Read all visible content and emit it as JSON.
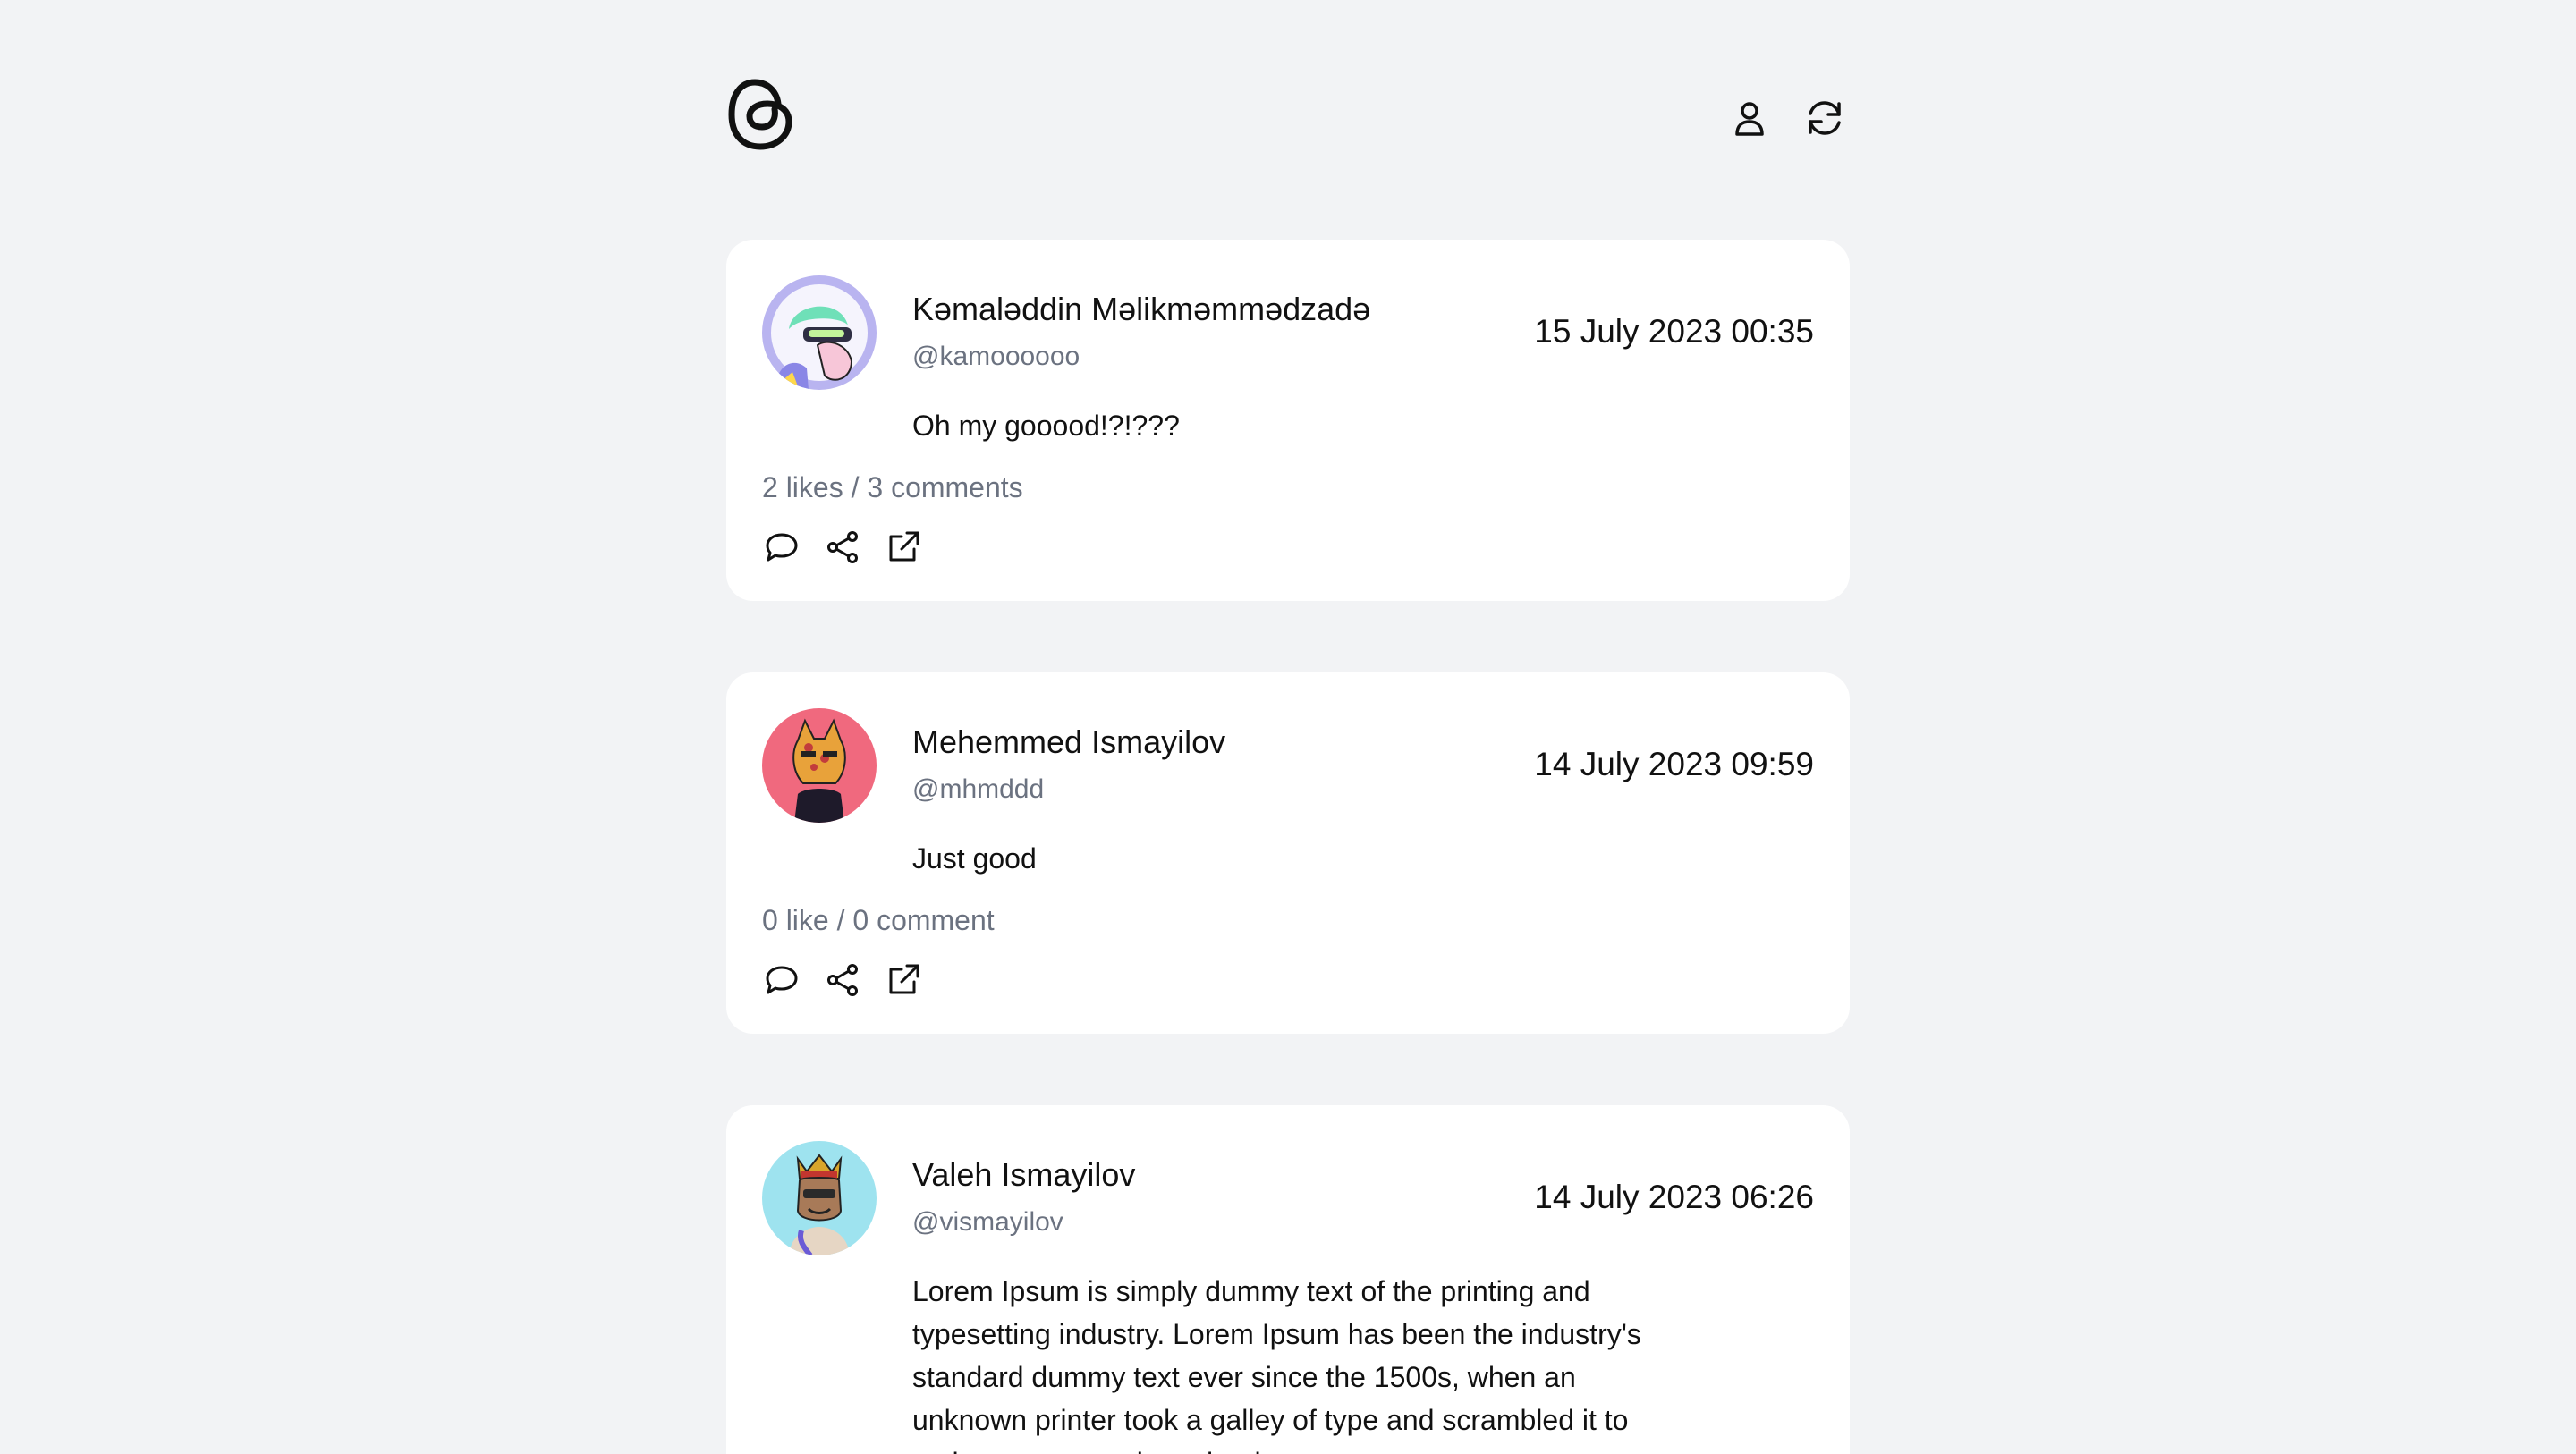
{
  "header": {
    "logo_icon": "threads-logo-icon",
    "profile_icon": "user-icon",
    "refresh_icon": "refresh-icon"
  },
  "posts": [
    {
      "name": "Kəmaləddin Məlikməmmədzadə",
      "handle": "@kamoooooo",
      "date": "15 July 2023 00:35",
      "text": "Oh my gooood!?!???",
      "stats": "2 likes / 3 comments",
      "avatar_bg": "#b9b4f0"
    },
    {
      "name": "Mehemmed Ismayilov",
      "handle": "@mhmddd",
      "date": "14 July 2023 09:59",
      "text": "Just good",
      "stats": "0 like / 0 comment",
      "avatar_bg": "#f0697e"
    },
    {
      "name": "Valeh Ismayilov",
      "handle": "@vismayilov",
      "date": "14 July 2023 06:26",
      "text": "Lorem Ipsum is simply dummy text of the printing and typesetting industry. Lorem Ipsum has been the industry's standard dummy text ever since the 1500s, when an unknown printer took a galley of type and scrambled it to make a type specimen book.",
      "stats": "",
      "avatar_bg": "#9ee3ef"
    }
  ],
  "colors": {
    "background": "#f2f3f5",
    "card": "#ffffff",
    "text": "#111111",
    "muted": "#6b7280"
  },
  "action_icons": [
    "comment-icon",
    "share-icon",
    "external-link-icon"
  ]
}
